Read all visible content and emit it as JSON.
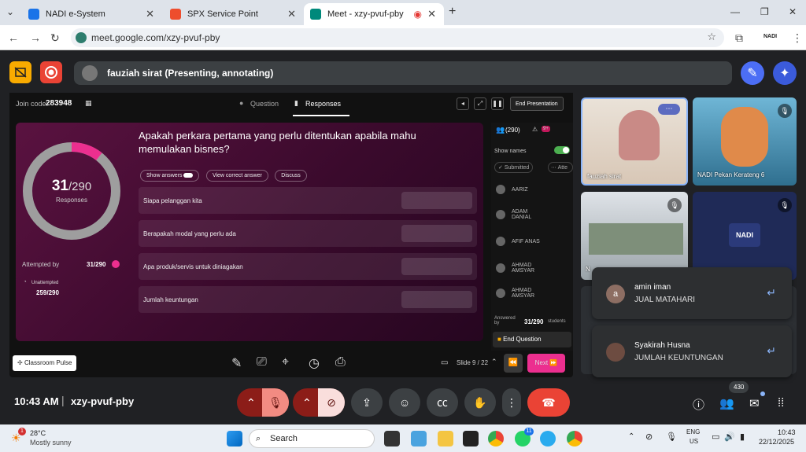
{
  "browser": {
    "tabs": [
      {
        "title": "NADI e-System",
        "fav": "#1a73e8"
      },
      {
        "title": "SPX Service Point",
        "fav": "#ee4d2d"
      },
      {
        "title": "Meet - xzy-pvuf-pby",
        "fav": "#00897b"
      }
    ],
    "url": "meet.google.com/xzy-pvuf-pby",
    "profile": "NADI"
  },
  "meet": {
    "presenter": "fauziah sirat (Presenting, annotating)",
    "stage": {
      "join_label": "Join code:",
      "join_code": "283948",
      "tab_question": "Question",
      "tab_responses": "Responses",
      "end_presentation": "End Presentation",
      "question": "Apakah perkara pertama yang perlu ditentukan apabila mahu memulakan bisnes?",
      "pills": [
        "Show answers",
        "View correct answer",
        "Discuss"
      ],
      "responses_count": "31",
      "responses_total": "/290",
      "responses_label": "Responses",
      "progress": 0.107,
      "attempted_label": "Attempted by",
      "attempted_value": "31/290",
      "unattempted_label": "Unattempted",
      "unattempted_value": "259/290",
      "options": [
        "Siapa pelanggan kita",
        "Berapakah modal yang perlu ada",
        "Apa produk/servis untuk diniagakan",
        "Jumlah keuntungan"
      ],
      "panel": {
        "count": "(290)",
        "alert": "9+",
        "show_names": "Show names",
        "submitted": "Submitted",
        "attempt": "Atte",
        "students": [
          "AARIZ",
          "ADAM DANIAL",
          "AFIF ANAS",
          "AHMAD AMSYAR",
          "AHMAD AMSYAR"
        ],
        "answered_label": "Answered by",
        "answered_value": "31/290",
        "answered_unit": "students",
        "end_question": "End Question"
      },
      "classroom_pulse": "Classroom Pulse",
      "slide_counter": "Slide 9 / 22",
      "next": "Next"
    },
    "tiles": [
      {
        "name": "fauziah sirat"
      },
      {
        "name": "NADI Pekan Kerateng 6"
      },
      {
        "name": "N"
      },
      {
        "name": "NADI"
      }
    ],
    "messages": [
      {
        "initial": "a",
        "name": "amin iman",
        "text": "JUAL MATAHARI"
      },
      {
        "initial": "",
        "name": "Syakirah Husna",
        "text": "JUMLAH KEUNTUNGAN"
      }
    ],
    "time": "10:43 AM",
    "meeting_code": "xzy-pvuf-pby",
    "people_count": "430"
  },
  "taskbar": {
    "weather_temp": "28°C",
    "weather_desc": "Mostly sunny",
    "weather_badge": "1",
    "search": "Search",
    "lang1": "ENG",
    "lang2": "US",
    "clock_time": "10:43",
    "clock_date": "22/12/2025",
    "whatsapp_badge": "11"
  },
  "colors": {
    "accent_pink": "#ec2f8f",
    "end_call": "#ea4335",
    "mute_red": "#8c1d18",
    "gauge_grey": "#9e9e9e"
  }
}
